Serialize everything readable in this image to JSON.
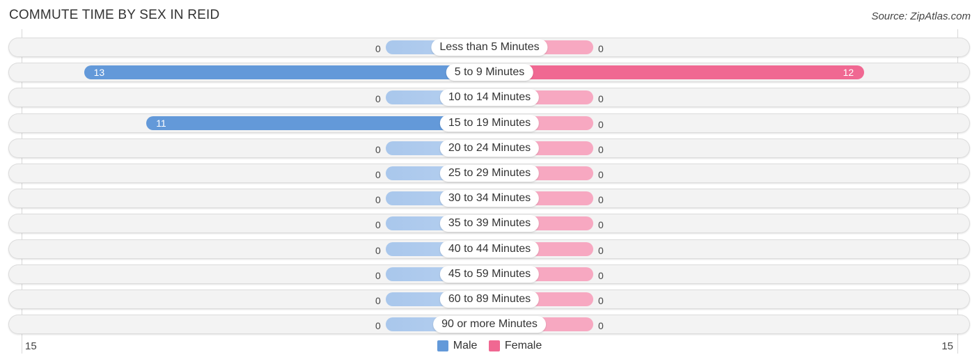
{
  "chart_data": {
    "type": "bar",
    "orientation": "horizontal-diverging",
    "title": "COMMUTE TIME BY SEX IN REID",
    "source": "Source: ZipAtlas.com",
    "categories": [
      "Less than 5 Minutes",
      "5 to 9 Minutes",
      "10 to 14 Minutes",
      "15 to 19 Minutes",
      "20 to 24 Minutes",
      "25 to 29 Minutes",
      "30 to 34 Minutes",
      "35 to 39 Minutes",
      "40 to 44 Minutes",
      "45 to 59 Minutes",
      "60 to 89 Minutes",
      "90 or more Minutes"
    ],
    "series": [
      {
        "name": "Male",
        "color": "#6399d9",
        "zero_color": "#a9c7ec",
        "values": [
          0,
          13,
          0,
          11,
          0,
          0,
          0,
          0,
          0,
          0,
          0,
          0
        ]
      },
      {
        "name": "Female",
        "color": "#f06892",
        "zero_color": "#f7a8c1",
        "values": [
          0,
          12,
          0,
          0,
          0,
          0,
          0,
          0,
          0,
          0,
          0,
          0
        ]
      }
    ],
    "xlim": [
      -15,
      15
    ],
    "axis_tick_labels": {
      "left": "15",
      "right": "15"
    },
    "legend": {
      "position": "bottom-center",
      "entries": [
        "Male",
        "Female"
      ]
    }
  }
}
